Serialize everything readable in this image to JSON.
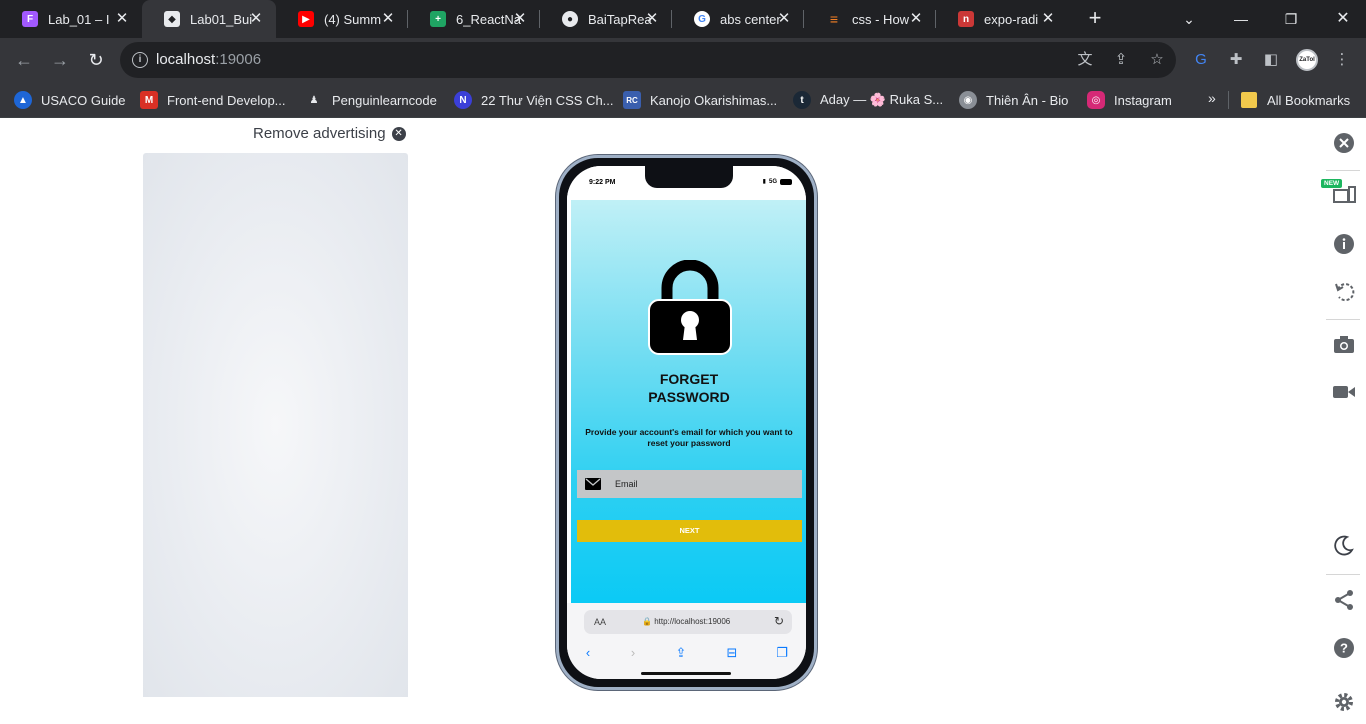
{
  "browser": {
    "tabs": [
      {
        "title": "Lab_01 – I",
        "favicon": "figma-icon",
        "color": "#a259ff"
      },
      {
        "title": "Lab01_Bui",
        "favicon": "page-icon",
        "color": "#e8eaed",
        "active": true
      },
      {
        "title": "(4) Summ",
        "favicon": "youtube-icon",
        "color": "#ff0000"
      },
      {
        "title": "6_ReactNa",
        "favicon": "sheets-icon",
        "color": "#1fa463"
      },
      {
        "title": "BaiTapRea",
        "favicon": "github-icon",
        "color": "#e8eaed"
      },
      {
        "title": "abs center",
        "favicon": "google-icon",
        "color": "#4285f4"
      },
      {
        "title": "css - How",
        "favicon": "stackoverflow-icon",
        "color": "#f48024"
      },
      {
        "title": "expo-radi",
        "favicon": "npm-icon",
        "color": "#cb3837"
      }
    ],
    "omnibox": {
      "host": "localhost",
      "port": ":19006"
    },
    "profile_initials": "ZaTol"
  },
  "bookmarks": [
    {
      "label": "USACO Guide",
      "icon": "usaco-icon",
      "color": "#1e66d6"
    },
    {
      "label": "Front-end Develop...",
      "icon": "m-icon",
      "color": "#d93025"
    },
    {
      "label": "Penguinlearncode",
      "icon": "penguin-icon",
      "color": "#e8eaed"
    },
    {
      "label": "22 Thư Viện CSS Ch...",
      "icon": "n-icon",
      "color": "#3b3fd8"
    },
    {
      "label": "Kanojo Okarishimas...",
      "icon": "rc-icon",
      "color": "#3a5fae"
    },
    {
      "label": "Aday — 🌸 Ruka S...",
      "icon": "tumblr-icon",
      "color": "#1b2836"
    },
    {
      "label": "Thiên Ân - Bio",
      "icon": "globe-icon",
      "color": "#8a8f96"
    },
    {
      "label": "Instagram",
      "icon": "instagram-icon",
      "color": "#d62976"
    }
  ],
  "all_bookmarks": "All Bookmarks",
  "ad": {
    "remove_label": "Remove advertising"
  },
  "device": {
    "time": "9:22 PM",
    "network": "5G",
    "title_line1": "FORGET",
    "title_line2": "PASSWORD",
    "description": "Provide your account's email for which you want to reset your password",
    "email_placeholder": "Email",
    "next_label": "NEXT",
    "safari_aa": "AA",
    "safari_url": "http://localhost:19006"
  },
  "tools": {
    "new_badge": "NEW"
  }
}
